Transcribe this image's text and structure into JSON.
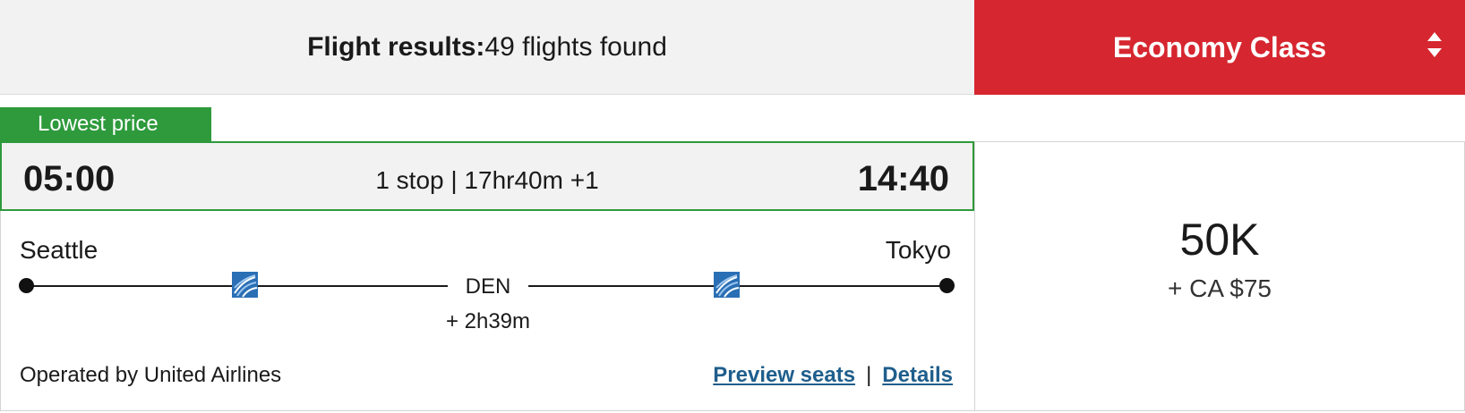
{
  "header": {
    "results_label": "Flight results:",
    "results_count": "49 flights found"
  },
  "cabin_select": {
    "selected": "Economy Class"
  },
  "flight": {
    "badge": "Lowest price",
    "departure_time": "05:00",
    "arrival_time": "14:40",
    "summary": "1 stop | 17hr40m +1",
    "origin": "Seattle",
    "destination": "Tokyo",
    "stop_code": "DEN",
    "layover": "+ 2h39m",
    "operated_by": "Operated by United Airlines",
    "links": {
      "preview_seats": "Preview seats",
      "separator": "|",
      "details": "Details"
    },
    "price": {
      "points": "50K",
      "cash": "+ CA $75"
    }
  },
  "colors": {
    "accent_red": "#d6262f",
    "badge_green": "#2e9a3c",
    "link_blue": "#1f5e8c"
  },
  "icons": {
    "airline": "united-globe-icon",
    "sort": "sort-arrows-icon"
  }
}
